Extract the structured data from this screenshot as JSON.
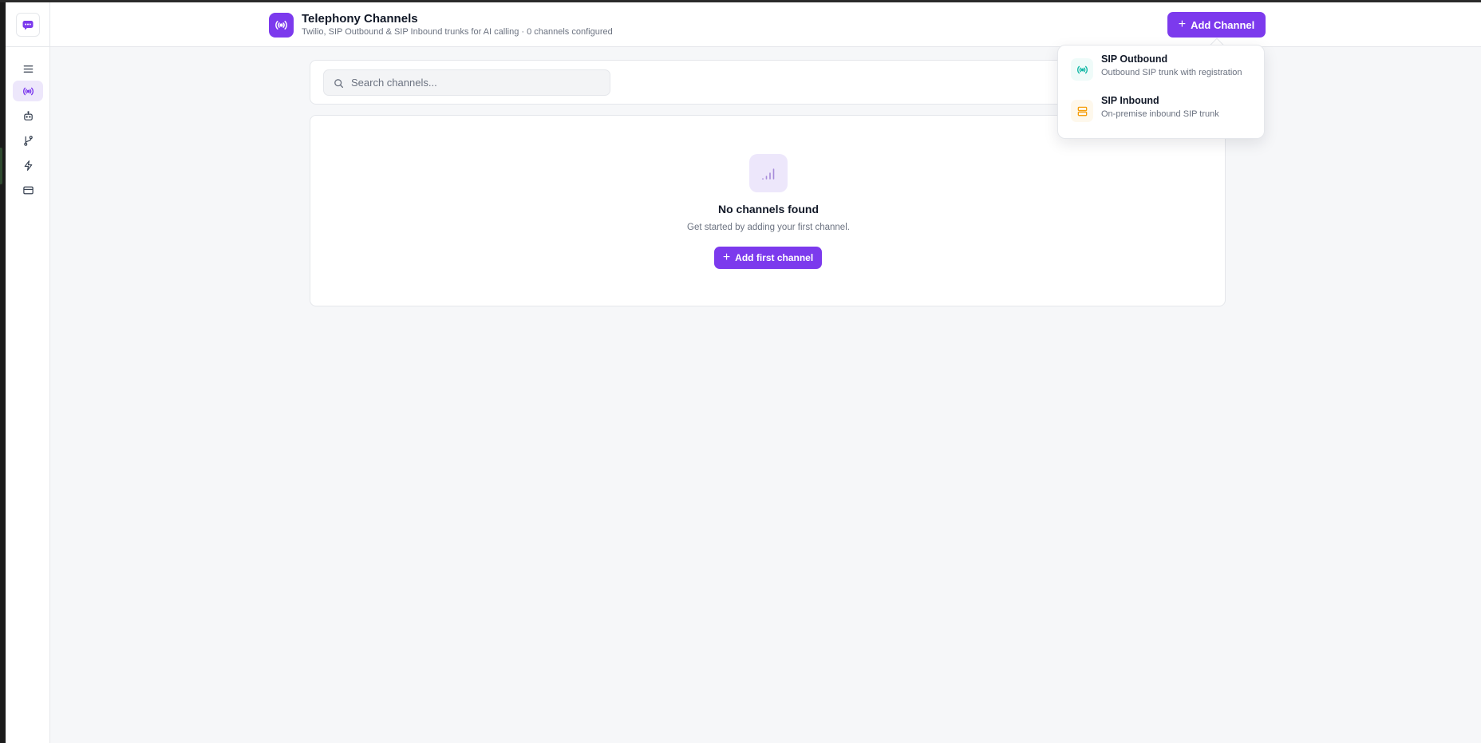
{
  "header": {
    "title": "Telephony Channels",
    "subtitle": "Twilio, SIP Outbound & SIP Inbound trunks for AI calling · 0 channels configured",
    "add_channel_label": "Add Channel"
  },
  "sidebar": {
    "items": [
      {
        "icon": "menu-icon"
      },
      {
        "icon": "radio-broadcast-icon",
        "active": true
      },
      {
        "icon": "robot-icon"
      },
      {
        "icon": "git-branch-icon"
      },
      {
        "icon": "lightning-icon"
      },
      {
        "icon": "credit-card-icon"
      }
    ]
  },
  "search": {
    "placeholder": "Search channels..."
  },
  "empty_state": {
    "title": "No channels found",
    "description": "Get started by adding your first channel.",
    "button_label": "Add first channel"
  },
  "dropdown": {
    "items": [
      {
        "title": "SIP Outbound",
        "description": "Outbound SIP trunk with registration",
        "icon": "radio-broadcast-icon",
        "color": "#14b8a6"
      },
      {
        "title": "SIP Inbound",
        "description": "On-premise inbound SIP trunk",
        "icon": "server-icon",
        "color": "#f59e0b"
      }
    ]
  },
  "colors": {
    "accent": "#7c3aed",
    "accent_light": "#ede7fb"
  }
}
